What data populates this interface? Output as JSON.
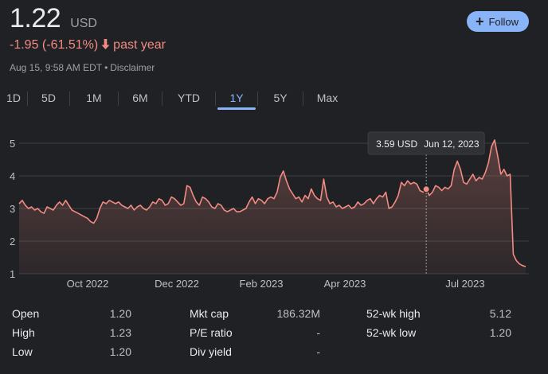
{
  "quote": {
    "price": "1.22",
    "currency": "USD",
    "change": "-1.95 (-61.51%)",
    "change_arrow": "🡓",
    "change_period": "past year",
    "timestamp": "Aug 15, 9:58 AM EDT",
    "separator": "•",
    "disclaimer": "Disclaimer"
  },
  "follow_button": {
    "icon": "plus-icon",
    "label": "Follow"
  },
  "ranges": [
    {
      "label": "1D"
    },
    {
      "label": "5D"
    },
    {
      "label": "1M"
    },
    {
      "label": "6M"
    },
    {
      "label": "YTD"
    },
    {
      "label": "1Y",
      "active": true
    },
    {
      "label": "5Y"
    },
    {
      "label": "Max"
    }
  ],
  "colors": {
    "line": "#f28b82",
    "accent": "#8ab4f8",
    "background": "#202124",
    "grid": "#3c4043",
    "tooltip_bg": "#303134"
  },
  "tooltip": {
    "price": "3.59 USD",
    "date": "Jun 12, 2023"
  },
  "chart_data": {
    "type": "area",
    "y_ticks": [
      "5",
      "4",
      "3",
      "2",
      "1"
    ],
    "ylim": [
      1,
      5
    ],
    "x_ticks": [
      "Oct 2022",
      "Dec 2022",
      "Feb 2023",
      "Apr 2023",
      "Jul 2023"
    ],
    "grid": true,
    "series": [
      {
        "values": [
          3.15,
          3.25,
          3.1,
          3.0,
          3.05,
          2.95,
          3.0,
          2.9,
          2.85,
          3.05,
          3.0,
          2.95,
          3.1,
          3.2,
          3.1,
          3.25,
          3.1,
          2.95,
          2.9,
          2.85,
          2.8,
          2.75,
          2.7,
          2.6,
          2.55,
          2.7,
          3.0,
          3.2,
          3.15,
          3.25,
          3.2,
          3.15,
          3.2,
          3.1,
          3.05,
          3.0,
          3.1,
          2.95,
          3.05,
          3.1,
          3.0,
          2.95,
          3.05,
          3.2,
          3.15,
          3.3,
          3.25,
          3.1,
          3.15,
          3.35,
          3.3,
          3.2,
          3.1,
          3.15,
          3.7,
          3.65,
          3.4,
          3.2,
          3.1,
          3.35,
          3.3,
          3.2,
          3.05,
          3.0,
          3.15,
          3.1,
          2.95,
          2.9,
          2.95,
          3.0,
          2.9,
          2.9,
          2.95,
          3.0,
          3.2,
          3.35,
          3.15,
          3.3,
          3.25,
          3.15,
          3.3,
          3.35,
          3.3,
          3.5,
          3.95,
          4.15,
          3.85,
          3.6,
          3.45,
          3.3,
          3.35,
          3.2,
          3.4,
          3.3,
          3.6,
          3.4,
          3.3,
          3.25,
          3.9,
          3.35,
          3.15,
          3.2,
          3.05,
          3.1,
          3.0,
          3.05,
          3.1,
          3.0,
          3.05,
          3.2,
          3.1,
          3.15,
          3.25,
          3.3,
          3.15,
          3.3,
          3.4,
          3.35,
          3.5,
          3.0,
          3.05,
          3.2,
          3.4,
          3.8,
          3.7,
          3.85,
          3.75,
          3.8,
          3.75,
          3.55,
          3.5,
          3.6,
          3.4,
          3.5,
          3.7,
          3.65,
          3.55,
          3.65,
          3.6,
          3.7,
          4.2,
          4.45,
          4.2,
          3.8,
          3.75,
          3.9,
          4.05,
          3.85,
          3.95,
          3.9,
          4.1,
          4.4,
          4.9,
          5.1,
          4.6,
          4.05,
          4.2,
          4.0,
          4.05,
          1.6,
          1.4,
          1.3,
          1.25,
          1.22
        ],
        "highlight": {
          "label": "3.59 USD",
          "date": "Jun 12, 2023",
          "value": 3.59
        }
      }
    ]
  },
  "stats": [
    [
      {
        "label": "Open",
        "value": "1.20"
      },
      {
        "label": "High",
        "value": "1.23"
      },
      {
        "label": "Low",
        "value": "1.20"
      }
    ],
    [
      {
        "label": "Mkt cap",
        "value": "186.32M"
      },
      {
        "label": "P/E ratio",
        "value": "-"
      },
      {
        "label": "Div yield",
        "value": "-"
      }
    ],
    [
      {
        "label": "52-wk high",
        "value": "5.12"
      },
      {
        "label": "52-wk low",
        "value": "1.20"
      }
    ]
  ]
}
